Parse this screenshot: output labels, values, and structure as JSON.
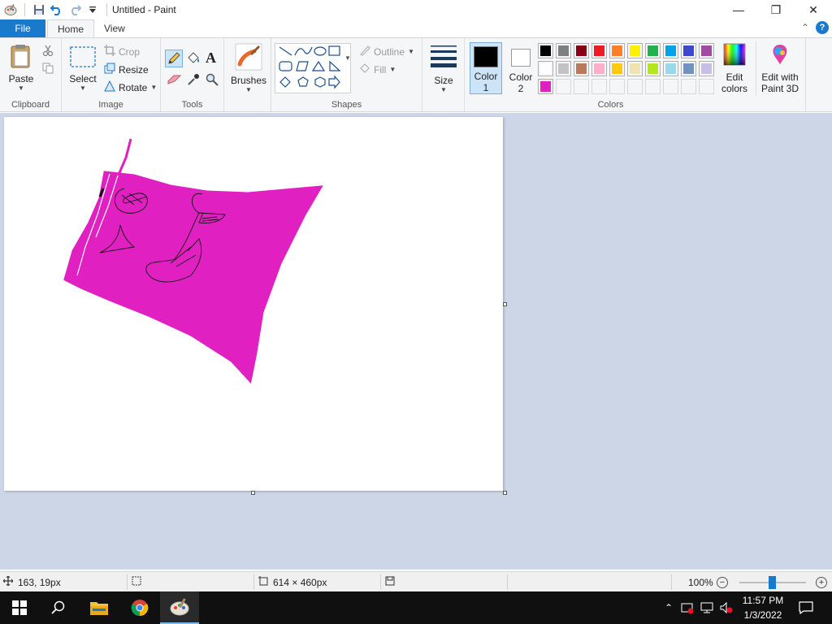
{
  "window": {
    "title": "Untitled - Paint",
    "minimize_glyph": "—",
    "restore_glyph": "❐",
    "close_glyph": "✕"
  },
  "tabs": [
    {
      "label": "File"
    },
    {
      "label": "Home"
    },
    {
      "label": "View"
    }
  ],
  "help_glyph": "?",
  "collapse_glyph": "⌃",
  "ribbon": {
    "clipboard": {
      "label": "Clipboard",
      "paste": "Paste"
    },
    "image": {
      "label": "Image",
      "select": "Select",
      "crop": "Crop",
      "resize": "Resize",
      "rotate": "Rotate"
    },
    "tools": {
      "label": "Tools"
    },
    "brushes": {
      "label": "Brushes"
    },
    "shapes": {
      "label": "Shapes",
      "outline": "Outline",
      "fill": "Fill"
    },
    "size": {
      "label": "Size"
    },
    "colors": {
      "label": "Colors",
      "color1": "Color",
      "color1_num": "1",
      "color2": "Color",
      "color2_num": "2",
      "color1_value": "#000000",
      "color2_value": "#ffffff",
      "edit_colors_1": "Edit",
      "edit_colors_2": "colors",
      "paint3d_1": "Edit with",
      "paint3d_2": "Paint 3D",
      "palette_row1": [
        "#000000",
        "#7f7f7f",
        "#880015",
        "#ed1c24",
        "#ff7f27",
        "#fff200",
        "#22b14c",
        "#00a2e8",
        "#3f48cc",
        "#a349a4"
      ],
      "palette_row2": [
        "#ffffff",
        "#c3c3c3",
        "#b97a57",
        "#ffaec9",
        "#ffc90e",
        "#efe4b0",
        "#b5e61d",
        "#99d9ea",
        "#7092be",
        "#c8bfe7"
      ],
      "palette_row3": [
        "#e020c0",
        "#ffffff",
        "#ffffff",
        "#ffffff",
        "#ffffff",
        "#ffffff",
        "#ffffff",
        "#ffffff",
        "#ffffff",
        "#ffffff"
      ]
    }
  },
  "status": {
    "cursor_pos": "163, 19px",
    "canvas_size": "614 × 460px",
    "zoom": "100%",
    "zoom_minus": "−",
    "zoom_plus": "+"
  },
  "taskbar": {
    "time": "11:57 PM",
    "date": "1/3/2022"
  }
}
